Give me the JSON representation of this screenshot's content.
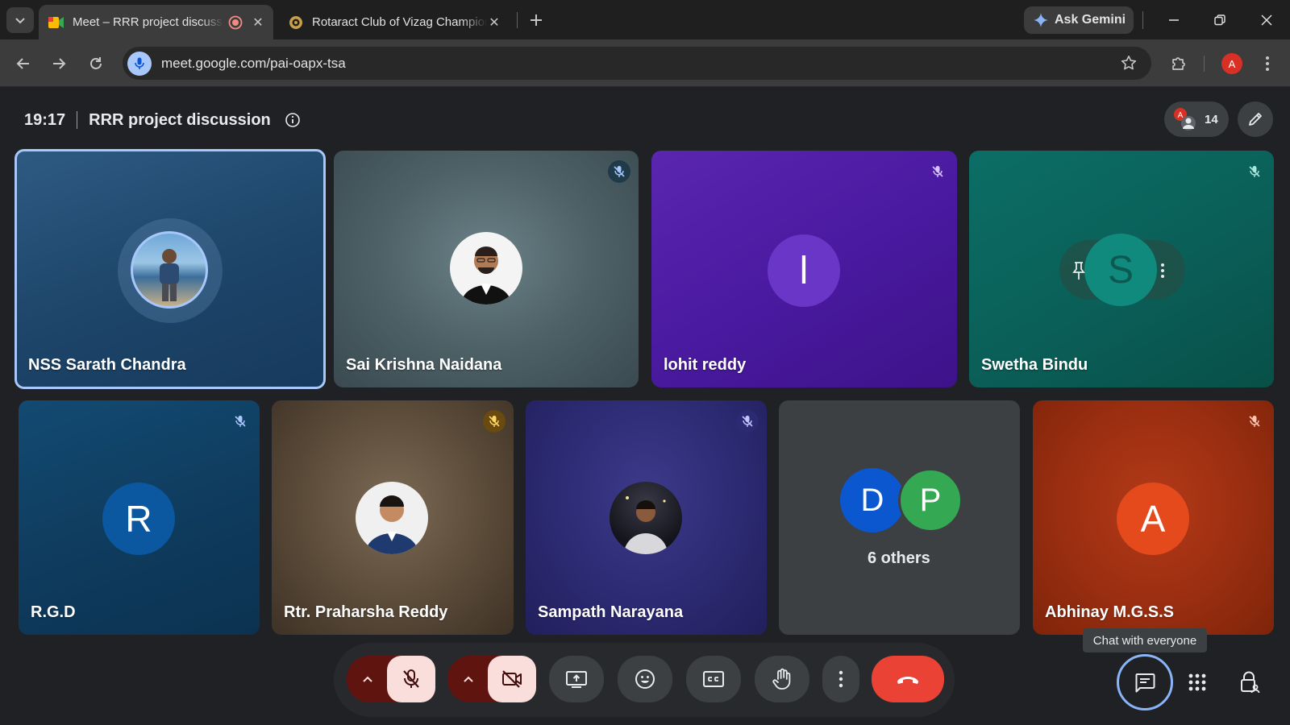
{
  "browser": {
    "tabs": [
      {
        "title": "Meet – RRR project discussion",
        "active": true,
        "favicon": "meet-icon",
        "recording_indicator": "record-icon"
      },
      {
        "title": "Rotaract Club of Vizag Champions",
        "active": false,
        "favicon": "rotaract-icon"
      }
    ],
    "gemini_label": "Ask Gemini",
    "url": "meet.google.com/pai-oapx-tsa",
    "profile_initial": "A"
  },
  "meet": {
    "time": "19:17",
    "title": "RRR project discussion",
    "participant_count": "14",
    "participants": [
      {
        "name": "NSS Sarath Chandra",
        "avatar": "photo",
        "muted": false,
        "speaking_highlight": true
      },
      {
        "name": "Sai Krishna Naidana",
        "avatar": "photo",
        "muted": true
      },
      {
        "name": "lohit reddy",
        "initial": "l",
        "muted": true
      },
      {
        "name": "Swetha Bindu",
        "initial": "S",
        "muted": true
      },
      {
        "name": "R.G.D",
        "initial": "R",
        "muted": true
      },
      {
        "name": "Rtr. Praharsha Reddy",
        "avatar": "photo",
        "muted": true
      },
      {
        "name": "Sampath Narayana",
        "avatar": "photo",
        "muted": true
      },
      {
        "name": "Abhinay M.G.S.S",
        "initial": "A",
        "muted": true
      }
    ],
    "others_tile": {
      "initials": [
        "D",
        "P"
      ],
      "label": "6 others"
    },
    "tooltip": "Chat with everyone",
    "colors": {
      "accent": "#a8c7fa",
      "end_call": "#ea4335",
      "mic_off_bg": "#f9dedc",
      "mic_options_bg": "#601410"
    }
  }
}
